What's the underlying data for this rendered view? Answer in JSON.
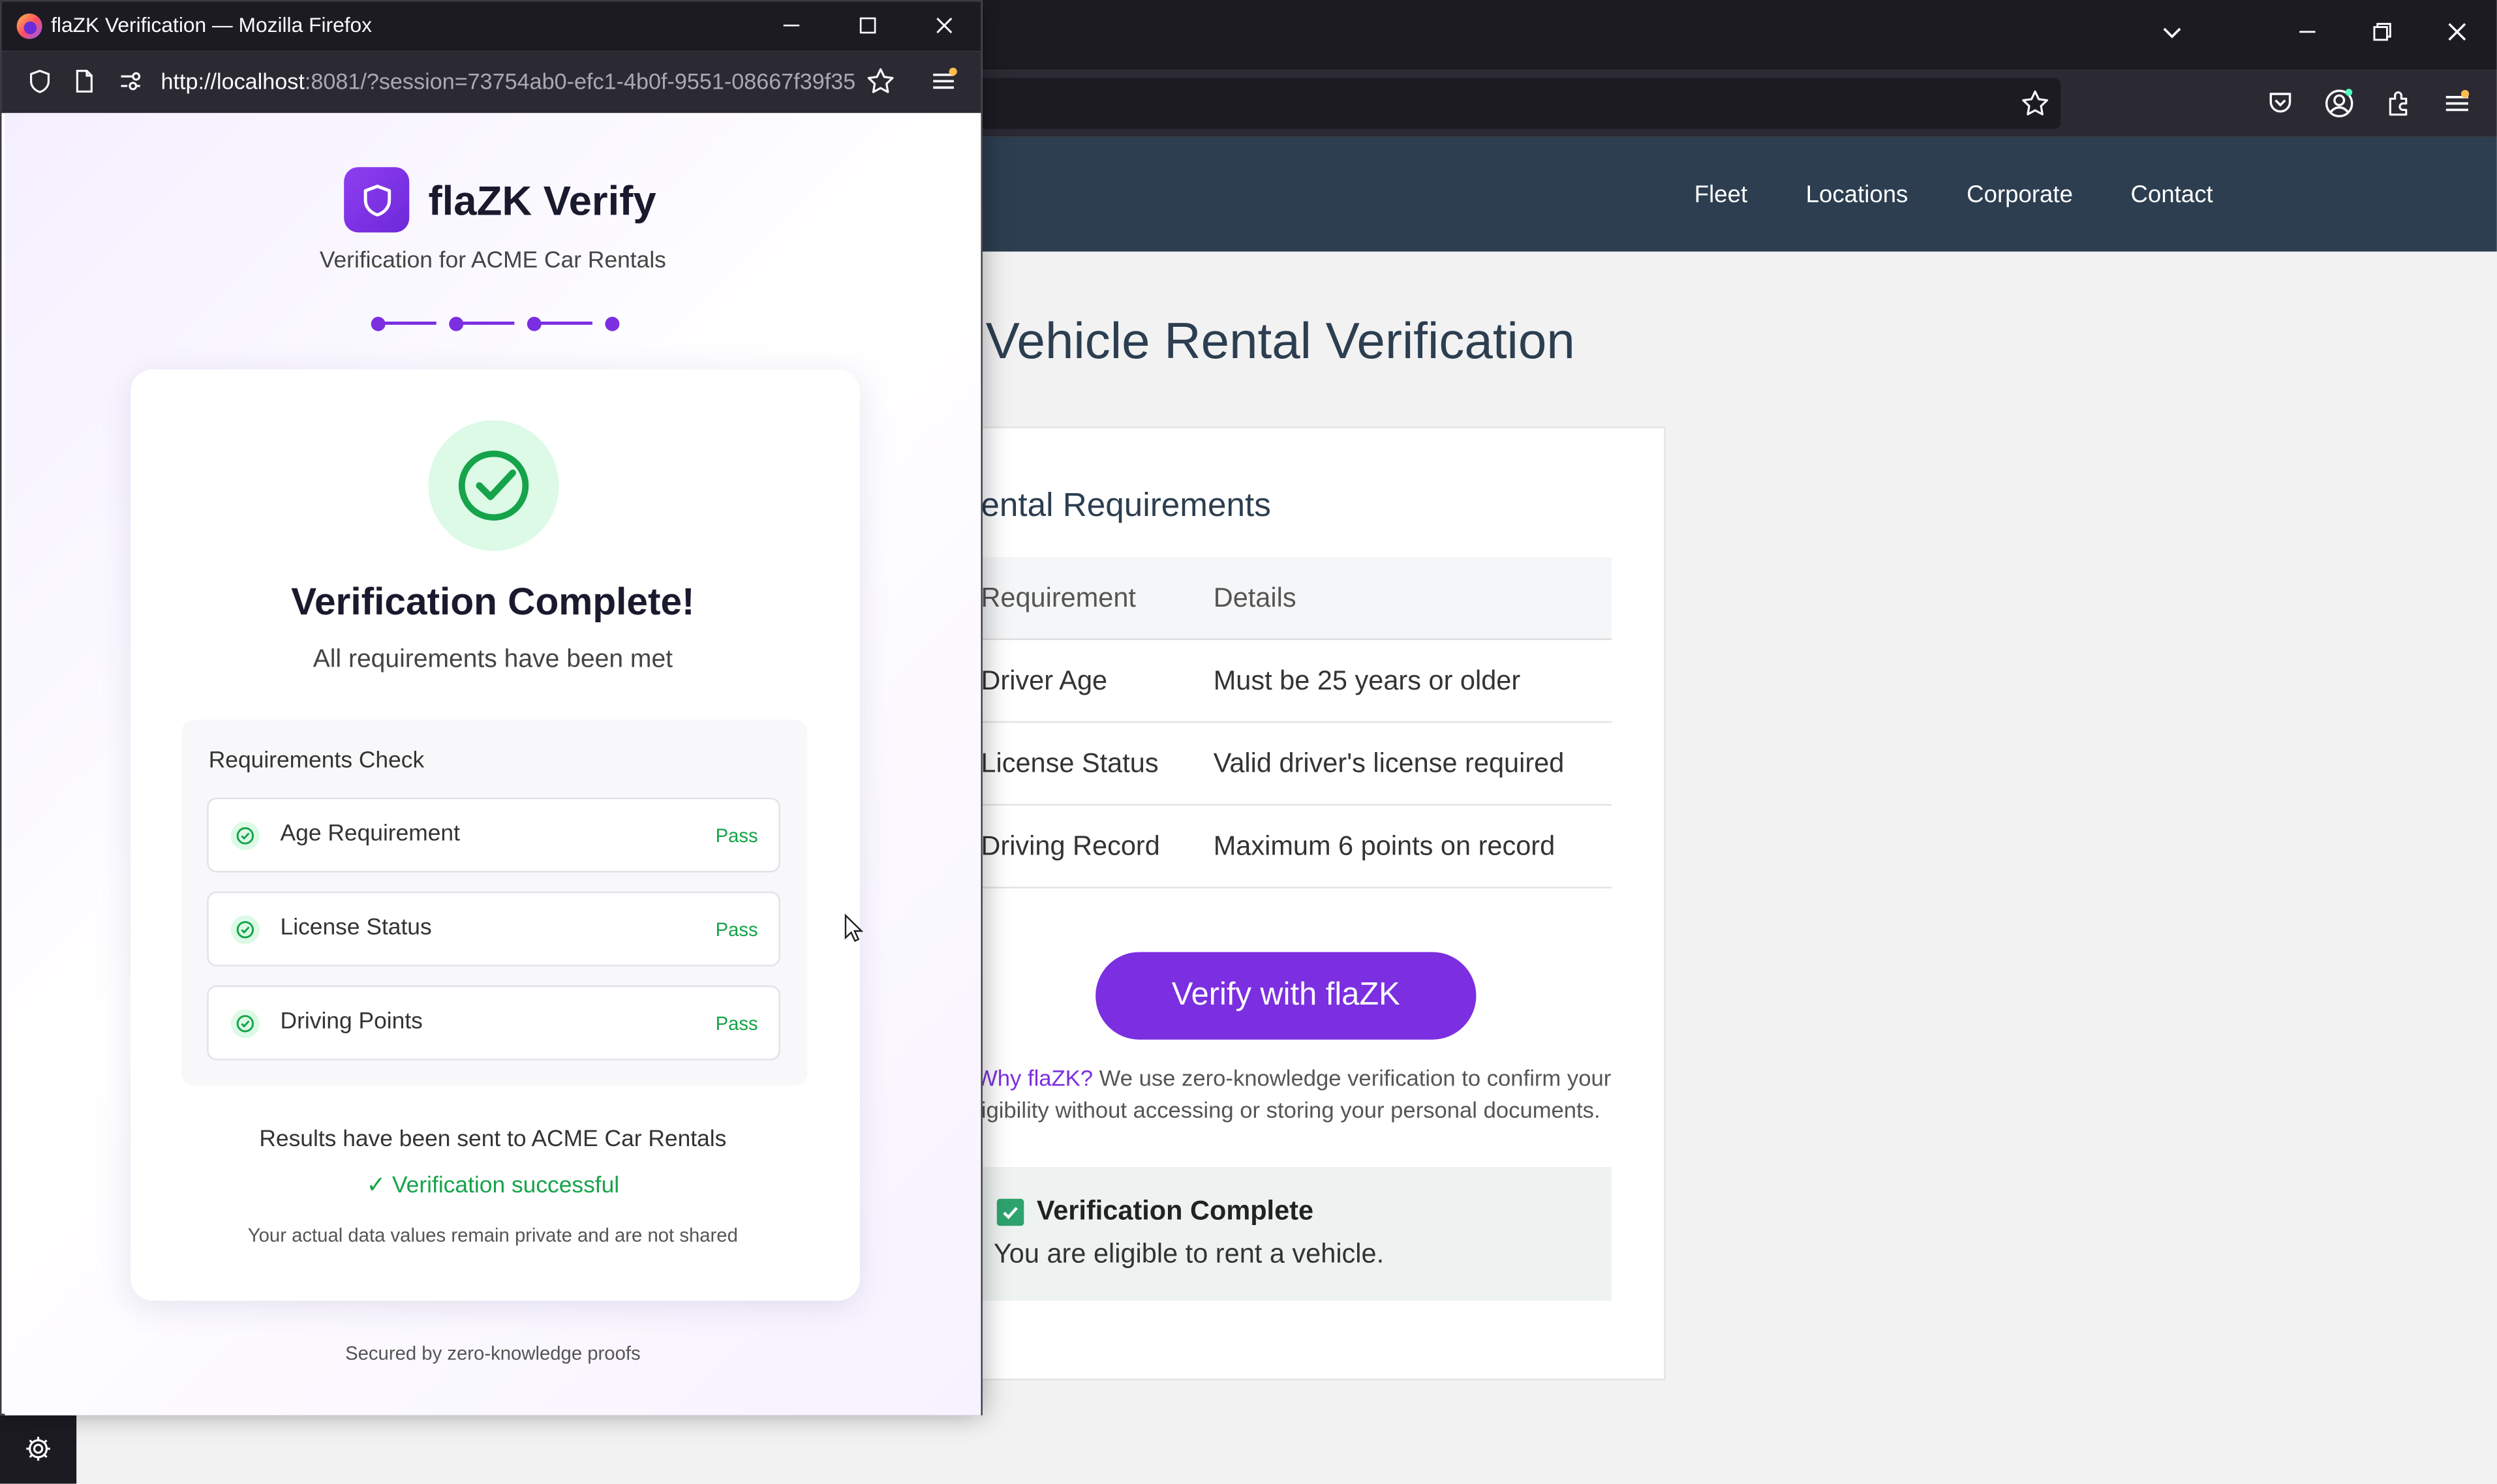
{
  "background_site": {
    "nav": [
      "Fleet",
      "Locations",
      "Corporate",
      "Contact"
    ],
    "page_heading": "Vehicle Rental Verification",
    "card_title": "ental Requirements",
    "table": {
      "headers": [
        "Requirement",
        "Details"
      ],
      "rows": [
        [
          "Driver Age",
          "Must be 25 years or older"
        ],
        [
          "License Status",
          "Valid driver's license required"
        ],
        [
          "Driving Record",
          "Maximum 6 points on record"
        ]
      ]
    },
    "verify_button": "Verify with flaZK",
    "why_link": "Why flaZK?",
    "why_text_1": " We use zero-knowledge verification to confirm your",
    "why_text_2": "ligibility without accessing or storing your personal documents.",
    "verification_box": {
      "title": "Verification Complete",
      "text": "You are eligible to rent a vehicle."
    }
  },
  "popup": {
    "window_title": "flaZK Verification — Mozilla Firefox",
    "url_host": "http://localhost",
    "url_rest": ":8081/?session=73754ab0-efc1-4b0f-9551-08667f39f35",
    "brand_name": "flaZK Verify",
    "brand_sub": "Verification for ACME Car Rentals",
    "title": "Verification Complete!",
    "subtitle": "All requirements have been met",
    "requirements_title": "Requirements Check",
    "requirements": [
      {
        "label": "Age Requirement",
        "status": "Pass"
      },
      {
        "label": "License Status",
        "status": "Pass"
      },
      {
        "label": "Driving Points",
        "status": "Pass"
      }
    ],
    "results_sent": "Results have been sent to ACME Car Rentals",
    "success": "✓ Verification successful",
    "private_note": "Your actual data values remain private and are not shared",
    "secured_note": "Secured by zero-knowledge proofs"
  },
  "colors": {
    "brand_purple": "#7b2fe0",
    "nav_bg": "#2c3e50",
    "pass_green": "#16a34a"
  },
  "icons": [
    "firefox-icon",
    "minimize-icon",
    "maximize-icon",
    "close-icon",
    "shield-icon",
    "page-icon",
    "permissions-icon",
    "bookmark-star-icon",
    "menu-icon",
    "check-circle-icon",
    "checkmark-icon",
    "gear-icon",
    "pocket-icon",
    "account-icon",
    "extensions-icon",
    "tab-list-icon"
  ]
}
